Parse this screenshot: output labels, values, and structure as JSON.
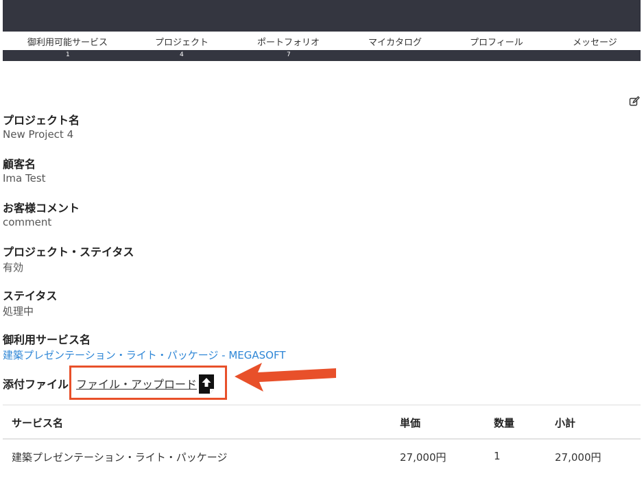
{
  "nav": {
    "items": [
      {
        "label": "御利用可能サービス",
        "count": "1"
      },
      {
        "label": "プロジェクト",
        "count": "4"
      },
      {
        "label": "ポートフォリオ",
        "count": "7"
      },
      {
        "label": "マイカタログ",
        "count": ""
      },
      {
        "label": "プロフィール",
        "count": ""
      },
      {
        "label": "メッセージ",
        "count": ""
      }
    ]
  },
  "project": {
    "name_label": "プロジェクト名",
    "name_value": "New Project 4",
    "customer_label": "顧客名",
    "customer_value": "Ima Test",
    "comment_label": "お客様コメント",
    "comment_value": "comment",
    "project_status_label": "プロジェクト・ステイタス",
    "project_status_value": "有効",
    "status_label": "ステイタス",
    "status_value": "処理中",
    "service_label": "御利用サービス名",
    "service_value": "建築プレゼンテーション・ライト・パッケージ - MEGASOFT",
    "attachment_label": "添付ファイル",
    "upload_link": "ファイル・アップロード"
  },
  "table": {
    "headers": [
      "サービス名",
      "単価",
      "数量",
      "小計"
    ],
    "rows": [
      [
        "建築プレゼンテーション・ライト・パッケージ",
        "27,000円",
        "1",
        "27,000円"
      ]
    ]
  },
  "icons": {
    "edit": "edit-icon",
    "upload": "upload-icon"
  },
  "colors": {
    "header_bg": "#343640",
    "link": "#2e86d6",
    "highlight": "#e8502a"
  }
}
